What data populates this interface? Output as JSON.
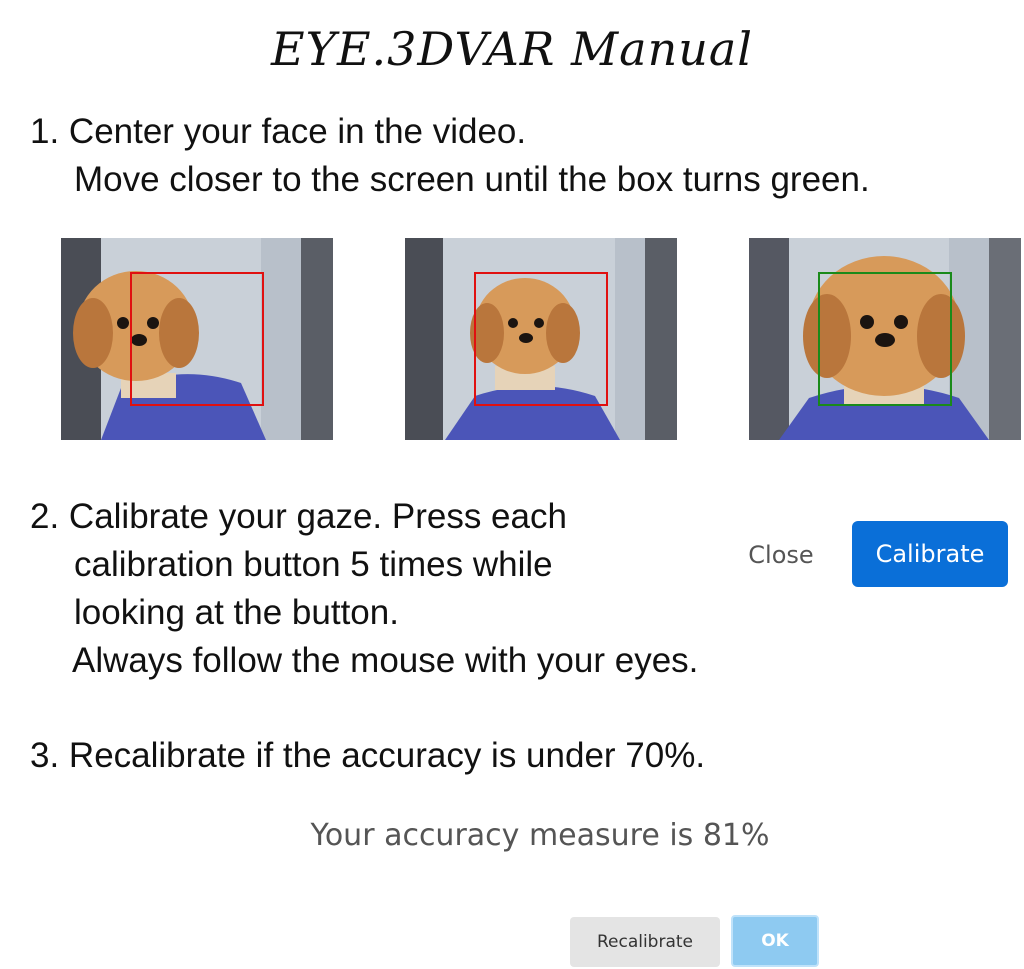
{
  "title": "EYE.3DVAR Manual",
  "step1": {
    "line1": "1. Center your face in the video.",
    "line2": "Move closer to the screen until the box turns green."
  },
  "frames": [
    {
      "box_color": "#e01010",
      "state": "too-far"
    },
    {
      "box_color": "#e01010",
      "state": "too-far"
    },
    {
      "box_color": "#1a8a1a",
      "state": "ok"
    }
  ],
  "step2": {
    "line1": "2. Calibrate your gaze. Press each",
    "line2": "calibration button 5 times while",
    "line3": "looking at the button.",
    "line4": "Always follow the mouse with your eyes."
  },
  "dialog1": {
    "close_label": "Close",
    "calibrate_label": "Calibrate",
    "accent": "#0a6fd8"
  },
  "step3": {
    "line1": "3. Recalibrate if the accuracy is under 70%."
  },
  "accuracy_dialog": {
    "message": "Your accuracy measure is 81%",
    "recalibrate_label": "Recalibrate",
    "ok_label": "OK"
  }
}
